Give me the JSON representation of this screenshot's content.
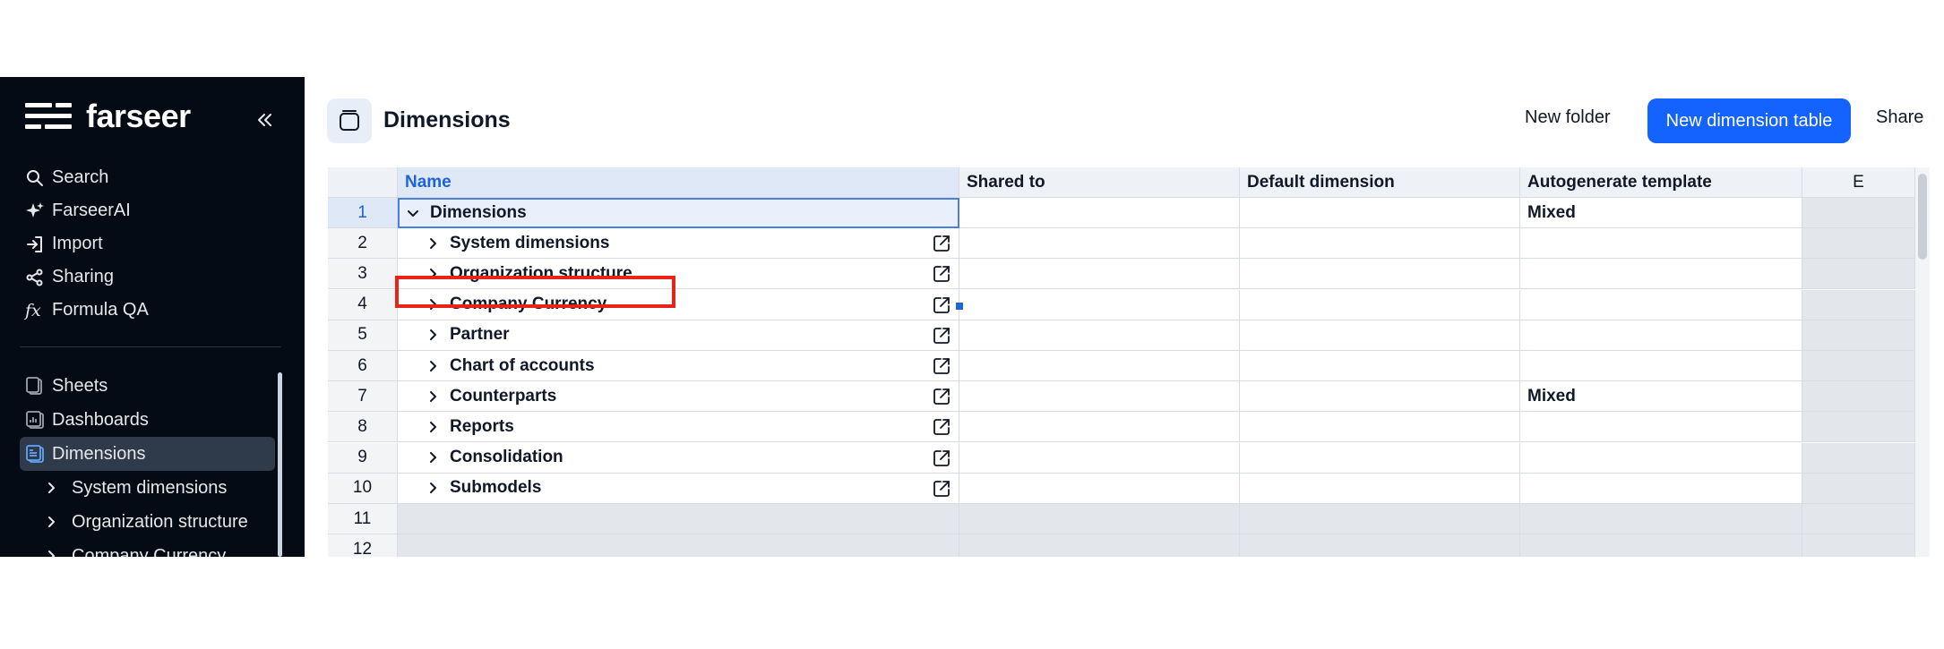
{
  "sidebar": {
    "logo_text": "farseer",
    "nav": [
      {
        "label": "Search",
        "icon": "search-icon"
      },
      {
        "label": "FarseerAI",
        "icon": "sparkle-icon"
      },
      {
        "label": "Import",
        "icon": "import-icon"
      },
      {
        "label": "Sharing",
        "icon": "share-icon"
      },
      {
        "label": "Formula QA",
        "icon": "fx-icon"
      }
    ],
    "sections": [
      {
        "label": "Sheets",
        "icon": "sheets-icon"
      },
      {
        "label": "Dashboards",
        "icon": "dashboards-icon"
      },
      {
        "label": "Dimensions",
        "icon": "dimensions-icon",
        "active": true
      }
    ],
    "sub_items": [
      "System dimensions",
      "Organization structure",
      "Company Currency"
    ]
  },
  "header": {
    "title": "Dimensions",
    "new_folder": "New folder",
    "new_dimension_table": "New dimension table",
    "share": "Share"
  },
  "table": {
    "columns": [
      "Name",
      "Shared to",
      "Default dimension",
      "Autogenerate template",
      "E"
    ],
    "rows": [
      {
        "index": "1",
        "name": "Dimensions",
        "expanded": true,
        "autogenerate": "Mixed"
      },
      {
        "index": "2",
        "name": "System dimensions",
        "autogenerate": ""
      },
      {
        "index": "3",
        "name": "Organization structure",
        "autogenerate": ""
      },
      {
        "index": "4",
        "name": "Company Currency",
        "autogenerate": ""
      },
      {
        "index": "5",
        "name": "Partner",
        "autogenerate": ""
      },
      {
        "index": "6",
        "name": "Chart of accounts",
        "autogenerate": ""
      },
      {
        "index": "7",
        "name": "Counterparts",
        "autogenerate": "Mixed"
      },
      {
        "index": "8",
        "name": "Reports",
        "autogenerate": ""
      },
      {
        "index": "9",
        "name": "Consolidation",
        "autogenerate": ""
      },
      {
        "index": "10",
        "name": "Submodels",
        "autogenerate": ""
      }
    ],
    "empty_rows": [
      "11",
      "12"
    ]
  },
  "colors": {
    "sidebar_bg": "#050b14",
    "primary": "#1463ff",
    "highlight": "#e8231a",
    "selected_header": "#1d63e0"
  }
}
